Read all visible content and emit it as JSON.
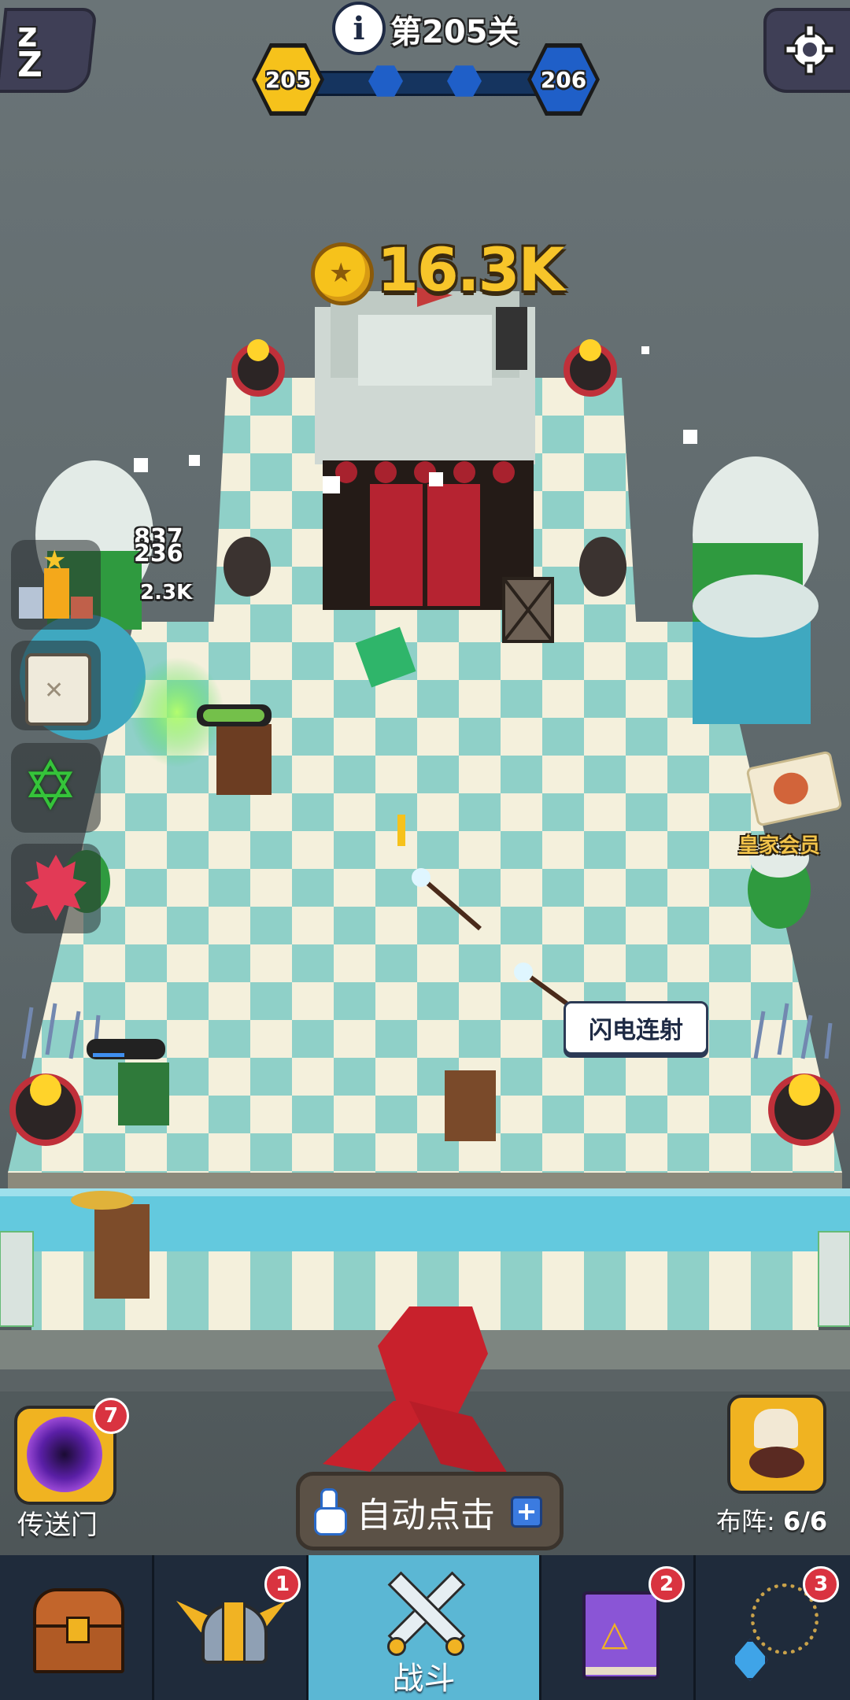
{
  "hud": {
    "level_title": "第205关",
    "current_level": "205",
    "next_level": "206",
    "sleep_icon": "zzz-icon",
    "settings_icon": "gear-icon",
    "info_icon": "info-icon"
  },
  "reward": {
    "coins": "16.3K",
    "icon": "gold-coin-icon"
  },
  "side_stats": {
    "value1": "837",
    "value2": "236",
    "value3": "2.3K"
  },
  "side_buttons": [
    "trophy-icon",
    "scroll-map-icon",
    "hexagram-icon",
    "maple-leaf-icon"
  ],
  "royal_member": {
    "label": "皇家会员"
  },
  "skill_popup": {
    "label": "闪电连射"
  },
  "portal": {
    "label": "传送门",
    "badge": "7"
  },
  "auto_click": {
    "label": "自动点击"
  },
  "formation": {
    "label": "布阵:",
    "value": "6/6"
  },
  "nav": [
    {
      "name": "chest",
      "badge": ""
    },
    {
      "name": "viking-helmet",
      "badge": "1"
    },
    {
      "name": "battle",
      "label": "战斗"
    },
    {
      "name": "spellbook",
      "badge": "2"
    },
    {
      "name": "amulet",
      "badge": "3"
    }
  ],
  "colors": {
    "gold": "#f6c21b",
    "blue_hex": "#1f5fc8",
    "nav_bg": "#1f2b3b",
    "nav_active": "#5bb7d4",
    "badge_red": "#d93340"
  }
}
